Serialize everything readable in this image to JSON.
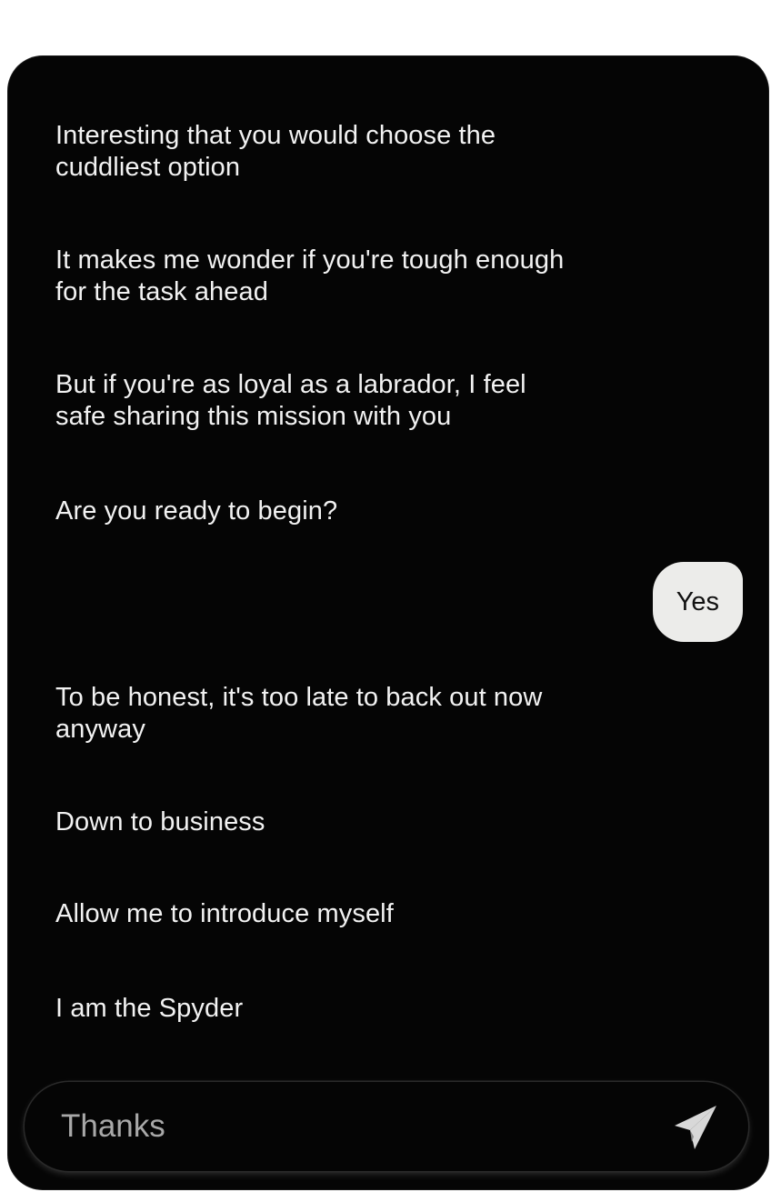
{
  "chat": {
    "messages": [
      {
        "sender": "bot",
        "text": "Interesting that you would choose the cuddliest option"
      },
      {
        "sender": "bot",
        "text": "It makes me wonder if you're tough enough for the task ahead"
      },
      {
        "sender": "bot",
        "text": "But if you're as loyal as a labrador, I feel safe sharing this mission with you"
      },
      {
        "sender": "bot",
        "text": "Are you ready to begin?"
      },
      {
        "sender": "user",
        "text": "Yes"
      },
      {
        "sender": "bot",
        "text": "To be honest, it's too late to back out now anyway"
      },
      {
        "sender": "bot",
        "text": "Down to business"
      },
      {
        "sender": "bot",
        "text": "Allow me to introduce myself"
      },
      {
        "sender": "bot",
        "text": "I am the Spyder"
      }
    ]
  },
  "composer": {
    "placeholder": "Thanks",
    "send_icon": "paper-plane-icon"
  },
  "colors": {
    "panel_background": "#050505",
    "bot_text": "#f2f2f2",
    "user_bubble": "#ececea",
    "user_text": "#111111",
    "placeholder": "#a8a8a8",
    "send_icon": "#d8d8d8"
  }
}
